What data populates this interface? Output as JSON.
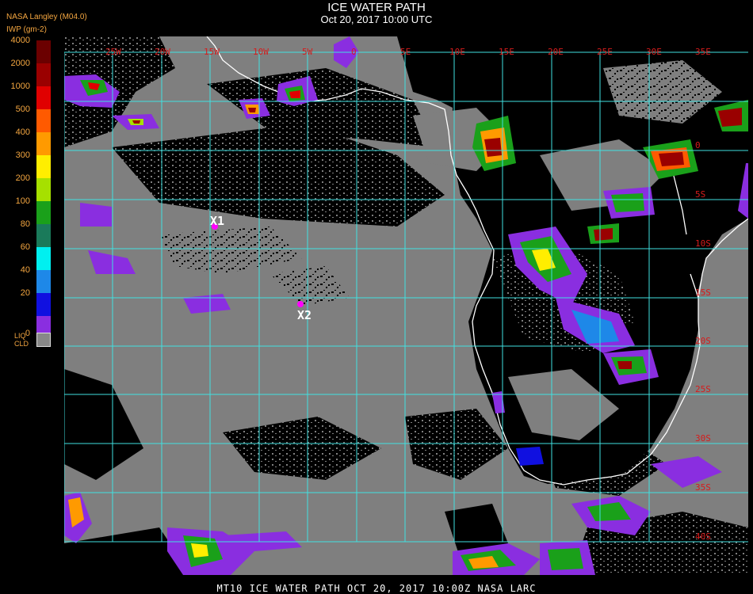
{
  "header": {
    "title": "ICE WATER PATH",
    "subtitle": "Oct 20, 2017 10:00 UTC",
    "source_label": "NASA Langley (M04.0)",
    "units_label": "IWP (gm-2)"
  },
  "legend": {
    "levels": [
      {
        "label": "4000",
        "color": "#6b0000"
      },
      {
        "label": "2000",
        "color": "#9a0000"
      },
      {
        "label": "1000",
        "color": "#e00000"
      },
      {
        "label": "500",
        "color": "#ff5a00"
      },
      {
        "label": "400",
        "color": "#ff9a00"
      },
      {
        "label": "300",
        "color": "#ffee00"
      },
      {
        "label": "200",
        "color": "#a6e000"
      },
      {
        "label": "100",
        "color": "#1aa01a"
      },
      {
        "label": "80",
        "color": "#1a7a5a"
      },
      {
        "label": "60",
        "color": "#00f0f0"
      },
      {
        "label": "40",
        "color": "#1e88e8"
      },
      {
        "label": "20",
        "color": "#1010e0"
      },
      {
        "label": "0",
        "color": "#8a2ee0"
      }
    ],
    "liquid_cloud_label_1": "LIQ",
    "liquid_cloud_label_2": "CLD",
    "liquid_cloud_color": "#888888"
  },
  "map": {
    "longitude_labels": [
      "25W",
      "20W",
      "15W",
      "10W",
      "5W",
      "0",
      "5E",
      "10E",
      "15E",
      "20E",
      "25E",
      "30E",
      "35E"
    ],
    "latitude_labels": [
      "0",
      "5S",
      "10S",
      "15S",
      "20S",
      "25S",
      "30S",
      "35S",
      "40S"
    ],
    "grid_color": "#40e0e0",
    "coastline_color": "#ffffff",
    "markers": [
      {
        "label": "X1",
        "color": "#ff00ff"
      },
      {
        "label": "X2",
        "color": "#ff00ff"
      }
    ]
  },
  "footer": {
    "text": "MT10  ICE WATER PATH   OCT 20, 2017 10:00Z   NASA LARC"
  }
}
